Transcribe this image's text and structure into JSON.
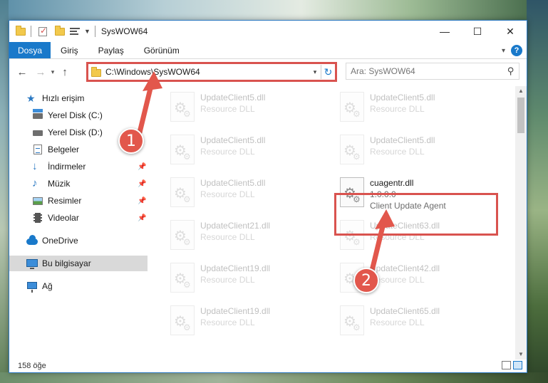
{
  "window": {
    "title": "SysWOW64",
    "controls": {
      "minimize": "—",
      "maximize": "☐",
      "close": "✕"
    }
  },
  "ribbon": {
    "file_tab": "Dosya",
    "tabs": [
      "Giriş",
      "Paylaş",
      "Görünüm"
    ]
  },
  "address": {
    "path": "C:\\Windows\\SysWOW64",
    "search_placeholder": "Ara: SysWOW64"
  },
  "sidebar": {
    "items": [
      {
        "label": "Hızlı erişim",
        "icon": "star-icon",
        "pinned": false
      },
      {
        "label": "Yerel Disk (C:)",
        "icon": "drive-c-icon",
        "pinned": false
      },
      {
        "label": "Yerel Disk (D:)",
        "icon": "drive-icon",
        "pinned": false
      },
      {
        "label": "Belgeler",
        "icon": "documents-icon",
        "pinned": false
      },
      {
        "label": "İndirmeler",
        "icon": "download-icon",
        "pinned": true
      },
      {
        "label": "Müzik",
        "icon": "music-icon",
        "pinned": true
      },
      {
        "label": "Resimler",
        "icon": "pictures-icon",
        "pinned": true
      },
      {
        "label": "Videolar",
        "icon": "videos-icon",
        "pinned": true
      },
      {
        "label": "OneDrive",
        "icon": "cloud-icon",
        "pinned": false
      },
      {
        "label": "Bu bilgisayar",
        "icon": "computer-icon",
        "pinned": false,
        "selected": true
      },
      {
        "label": "Ağ",
        "icon": "network-icon",
        "pinned": false
      }
    ]
  },
  "files": {
    "left": [
      {
        "name": "UpdateClient5.dll",
        "desc": "Resource DLL"
      },
      {
        "name": "UpdateClient5.dll",
        "desc": "Resource DLL"
      },
      {
        "name": "UpdateClient5.dll",
        "desc": "Resource DLL"
      },
      {
        "name": "UpdateClient21.dll",
        "desc": "Resource DLL"
      },
      {
        "name": "UpdateClient19.dll",
        "desc": "Resource DLL"
      },
      {
        "name": "UpdateClient19.dll",
        "desc": "Resource DLL"
      }
    ],
    "right": [
      {
        "name": "UpdateClient5.dll",
        "desc": "Resource DLL"
      },
      {
        "name": "UpdateClient5.dll",
        "desc": "Resource DLL"
      },
      {
        "name": "UpdateClient63.dll",
        "desc": "Resource DLL"
      },
      {
        "name": "UpdateClient42.dll",
        "desc": "Resource DLL"
      },
      {
        "name": "UpdateClient65.dll",
        "desc": "Resource DLL"
      }
    ],
    "highlighted": {
      "name": "cuagentr.dll",
      "version": "1.0.0.0",
      "desc": "Client Update Agent"
    }
  },
  "status": {
    "count": "158 öğe"
  },
  "annotations": {
    "step1": "1",
    "step2": "2",
    "color": "#e2574c"
  }
}
